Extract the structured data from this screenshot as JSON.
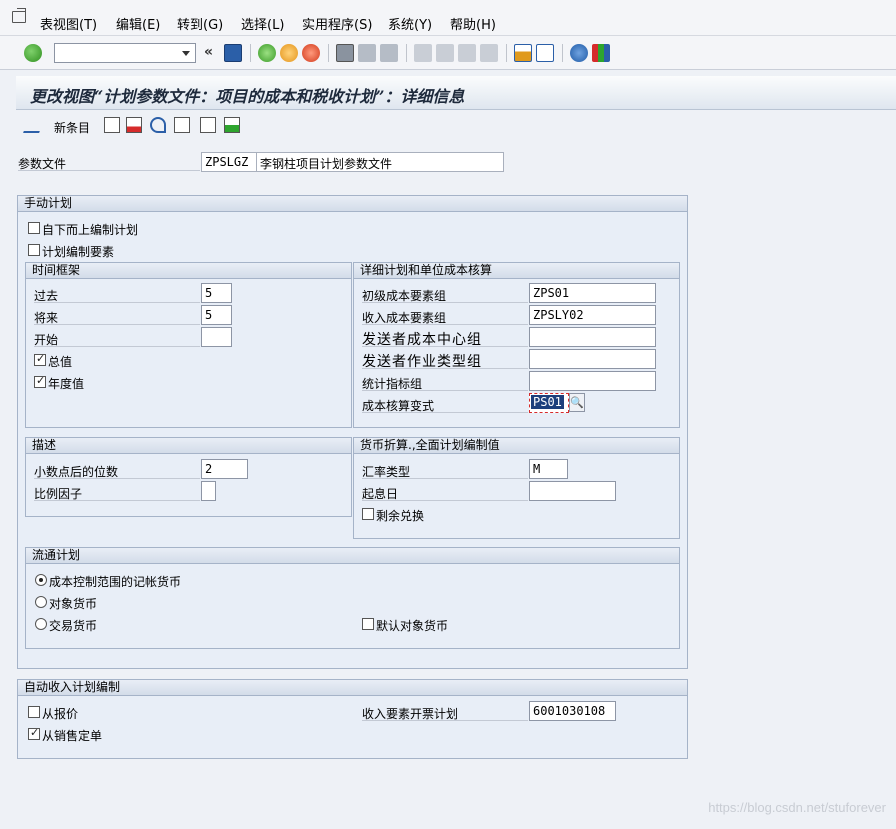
{
  "menubar": {
    "items": [
      "表视图(T)",
      "编辑(E)",
      "转到(G)",
      "选择(L)",
      "实用程序(S)",
      "系统(Y)",
      "帮助(H)"
    ]
  },
  "toolbar": {
    "command_value": "",
    "icons": [
      "enter-icon",
      "back-icon",
      "save-icon",
      "back-green-icon",
      "exit-icon",
      "cancel-icon",
      "print-icon",
      "find-icon",
      "find-next-icon",
      "first-page-icon",
      "prev-page-icon",
      "next-page-icon",
      "last-page-icon",
      "new-session-icon",
      "shortcut-icon",
      "help-icon",
      "layout-icon"
    ]
  },
  "title": "更改视图“计划参数文件：项目的成本和税收计划”：详细信息",
  "app_toolbar": {
    "new_entries_label": "新条目",
    "icons": [
      "display-change-icon",
      "copy-icon",
      "delete-icon",
      "undo-icon",
      "prev-entry-icon",
      "next-entry-icon",
      "select-all-icon"
    ]
  },
  "profile": {
    "label": "参数文件",
    "code": "ZPSLGZ",
    "description": "李钢柱项目计划参数文件"
  },
  "manual_planning": {
    "header": "手动计划",
    "top_down": {
      "label": "自下而上编制计划",
      "checked": false
    },
    "plan_elements": {
      "label": "计划编制要素",
      "checked": false
    },
    "time_frame": {
      "header": "时间框架",
      "past_label": "过去",
      "past_value": "5",
      "future_label": "将来",
      "future_value": "5",
      "start_label": "开始",
      "start_value": "",
      "overall_label": "总值",
      "overall_checked": true,
      "annual_label": "年度值",
      "annual_checked": true
    },
    "detail": {
      "header": "详细计划和单位成本核算",
      "primary_label": "初级成本要素组",
      "primary_value": "ZPS01",
      "revenue_label": "收入成本要素组",
      "revenue_value": "ZPSLY02",
      "sender_cc_label": "发送者成本中心组",
      "sender_cc_value": "",
      "sender_act_label": "发送者作业类型组",
      "sender_act_value": "",
      "stat_label": "统计指标组",
      "stat_value": "",
      "costing_label": "成本核算变式",
      "costing_value": "PS01"
    },
    "description": {
      "header": "描述",
      "decimals_label": "小数点后的位数",
      "decimals_value": "2",
      "scale_label": "比例因子",
      "scale_value": ""
    },
    "currency": {
      "header": "货币折算.,全面计划编制值",
      "rate_label": "汇率类型",
      "rate_value": "M",
      "start_label": "起息日",
      "start_value": "",
      "remaining_label": "剩余兑换",
      "remaining_checked": false
    },
    "currency_plan": {
      "header": "流通计划",
      "opt1": "成本控制范围的记帐货币",
      "opt2": "对象货币",
      "opt3": "交易货币",
      "default_label": "默认对象货币",
      "selected": 1
    }
  },
  "auto_revenue": {
    "header": "自动收入计划编制",
    "from_quote_label": "从报价",
    "from_quote_checked": false,
    "from_order_label": "从销售定单",
    "from_order_checked": true,
    "billing_label": "收入要素开票计划",
    "billing_value": "6001030108"
  },
  "watermark": "https://blog.csdn.net/stuforever"
}
